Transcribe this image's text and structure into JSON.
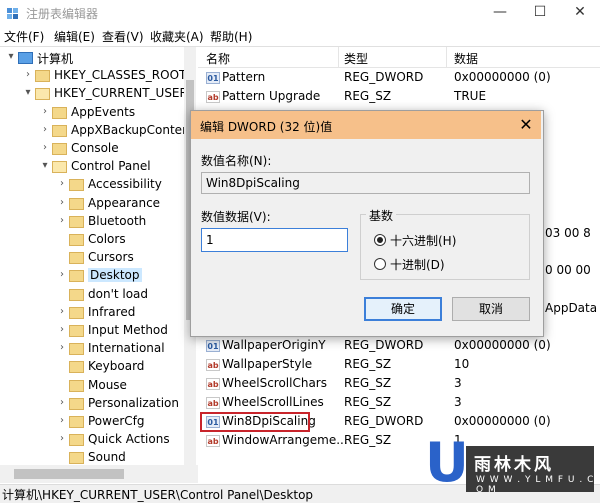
{
  "window": {
    "title": "注册表编辑器",
    "minimize": "—",
    "maximize": "☐",
    "close": "✕"
  },
  "menu": [
    "文件(F)",
    "编辑(E)",
    "查看(V)",
    "收藏夹(A)",
    "帮助(H)"
  ],
  "tree": [
    {
      "label": "计算机",
      "indent": 0,
      "arrow": "▾",
      "icon": "computer-icon"
    },
    {
      "label": "HKEY_CLASSES_ROOT",
      "indent": 1,
      "arrow": "›"
    },
    {
      "label": "HKEY_CURRENT_USER",
      "indent": 1,
      "arrow": "▾",
      "open": true
    },
    {
      "label": "AppEvents",
      "indent": 2,
      "arrow": "›"
    },
    {
      "label": "AppXBackupConter",
      "indent": 2,
      "arrow": "›"
    },
    {
      "label": "Console",
      "indent": 2,
      "arrow": "›"
    },
    {
      "label": "Control Panel",
      "indent": 2,
      "arrow": "▾",
      "open": true
    },
    {
      "label": "Accessibility",
      "indent": 3,
      "arrow": "›"
    },
    {
      "label": "Appearance",
      "indent": 3,
      "arrow": "›"
    },
    {
      "label": "Bluetooth",
      "indent": 3,
      "arrow": "›"
    },
    {
      "label": "Colors",
      "indent": 3,
      "arrow": ""
    },
    {
      "label": "Cursors",
      "indent": 3,
      "arrow": ""
    },
    {
      "label": "Desktop",
      "indent": 3,
      "arrow": "›",
      "selected": true
    },
    {
      "label": "don't load",
      "indent": 3,
      "arrow": ""
    },
    {
      "label": "Infrared",
      "indent": 3,
      "arrow": "›"
    },
    {
      "label": "Input Method",
      "indent": 3,
      "arrow": "›"
    },
    {
      "label": "International",
      "indent": 3,
      "arrow": "›"
    },
    {
      "label": "Keyboard",
      "indent": 3,
      "arrow": ""
    },
    {
      "label": "Mouse",
      "indent": 3,
      "arrow": ""
    },
    {
      "label": "Personalization",
      "indent": 3,
      "arrow": "›"
    },
    {
      "label": "PowerCfg",
      "indent": 3,
      "arrow": "›"
    },
    {
      "label": "Quick Actions",
      "indent": 3,
      "arrow": "›"
    },
    {
      "label": "Sound",
      "indent": 3,
      "arrow": ""
    }
  ],
  "list": {
    "headers": {
      "name": "名称",
      "type": "类型",
      "data": "数据"
    },
    "rows": [
      {
        "name": "Pattern",
        "type": "REG_DWORD",
        "data": "0x00000000 (0)",
        "icon": "dword"
      },
      {
        "name": "Pattern Upgrade",
        "type": "REG_SZ",
        "data": "TRUE",
        "icon": "sz"
      },
      {
        "name": "WallpaperOriginY",
        "type": "REG_DWORD",
        "data": "0x00000000 (0)",
        "icon": "dword"
      },
      {
        "name": "WallpaperStyle",
        "type": "REG_SZ",
        "data": "10",
        "icon": "sz"
      },
      {
        "name": "WheelScrollChars",
        "type": "REG_SZ",
        "data": "3",
        "icon": "sz"
      },
      {
        "name": "WheelScrollLines",
        "type": "REG_SZ",
        "data": "3",
        "icon": "sz"
      },
      {
        "name": "Win8DpiScaling",
        "type": "REG_DWORD",
        "data": "0x00000000 (0)",
        "icon": "dword"
      },
      {
        "name": "WindowArrangeme...",
        "type": "REG_SZ",
        "data": "1",
        "icon": "sz"
      }
    ],
    "hidden_fragments": [
      "03 00 8",
      "0 00 00",
      "AppData"
    ]
  },
  "dialog": {
    "title": "编辑 DWORD (32 位)值",
    "close": "✕",
    "name_label": "数值名称(N):",
    "name_value": "Win8DpiScaling",
    "data_label": "数值数据(V):",
    "data_value": "1",
    "base_label": "基数",
    "radio_hex": "十六进制(H)",
    "radio_dec": "十进制(D)",
    "ok": "确定",
    "cancel": "取消"
  },
  "status": "计算机\\HKEY_CURRENT_USER\\Control Panel\\Desktop",
  "watermark": {
    "letter": "U",
    "text1": "雨林木风",
    "text2": "W W W . Y L M F U . C O M"
  }
}
